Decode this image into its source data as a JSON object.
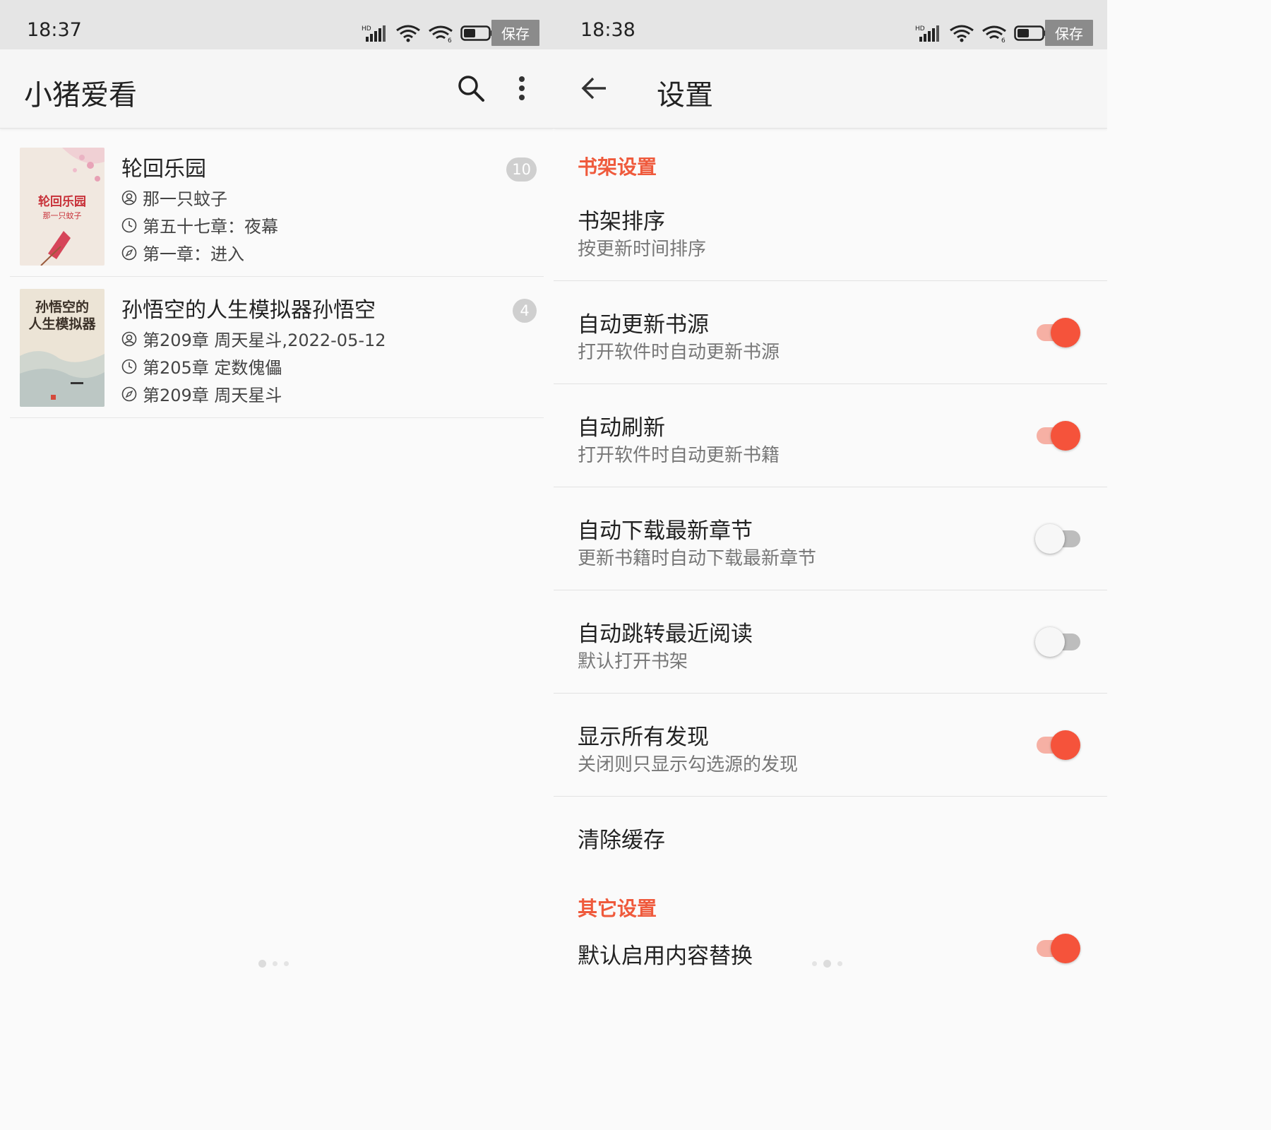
{
  "statusbar_left": {
    "time": "18:37",
    "save_label": "保存"
  },
  "statusbar_right": {
    "time": "18:38",
    "save_label": "保存"
  },
  "bookshelf": {
    "title": "小猪爱看",
    "books": [
      {
        "title": "轮回乐园",
        "author": "那一只蚊子",
        "latest_chapter": "第五十七章：夜幕",
        "current_chapter": "第一章：进入",
        "unread_count": "10",
        "cover_title": "轮回乐园",
        "cover_author": "那一只蚊子"
      },
      {
        "title": "孙悟空的人生模拟器孙悟空",
        "author": "第209章 周天星斗,2022-05-12",
        "latest_chapter": "第205章 定数傀儡",
        "current_chapter": "第209章 周天星斗",
        "unread_count": "4",
        "cover_title": "孙悟空的人生模拟器"
      }
    ]
  },
  "settings": {
    "title": "设置",
    "section_bookshelf": "书架设置",
    "section_other": "其它设置",
    "items": [
      {
        "title": "书架排序",
        "summary": "按更新时间排序"
      },
      {
        "title": "自动更新书源",
        "summary": "打开软件时自动更新书源",
        "on": true
      },
      {
        "title": "自动刷新",
        "summary": "打开软件时自动更新书籍",
        "on": true
      },
      {
        "title": "自动下载最新章节",
        "summary": "更新书籍时自动下载最新章节",
        "on": false
      },
      {
        "title": "自动跳转最近阅读",
        "summary": "默认打开书架",
        "on": false
      },
      {
        "title": "显示所有发现",
        "summary": "关闭则只显示勾选源的发现",
        "on": true
      },
      {
        "title": "清除缓存"
      },
      {
        "title": "默认启用内容替换",
        "on": true
      }
    ]
  },
  "colors": {
    "accent": "#f5533b",
    "section_header": "#ef5a3c"
  }
}
